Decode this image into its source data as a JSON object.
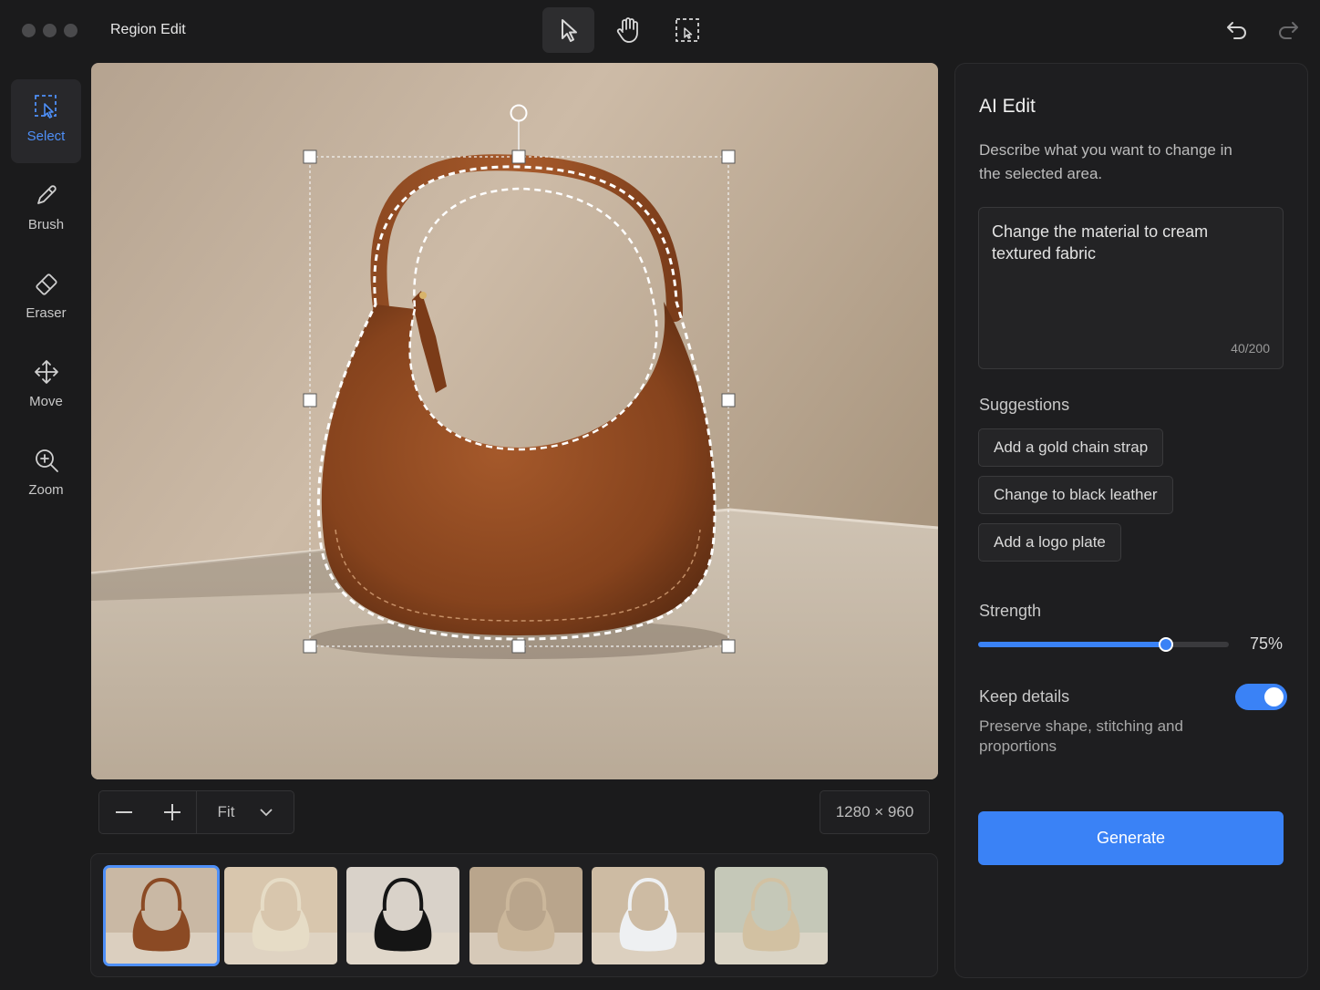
{
  "window": {
    "title": "Region Edit"
  },
  "top_toolbar": {
    "tools": [
      {
        "name": "pointer",
        "icon": "cursor-arrow-icon",
        "active": true
      },
      {
        "name": "hand",
        "icon": "hand-icon",
        "active": false
      },
      {
        "name": "region",
        "icon": "region-select-icon",
        "active": false
      }
    ],
    "undo_icon": "undo-icon",
    "redo_icon": "redo-icon"
  },
  "left_tools": [
    {
      "label": "Select",
      "icon": "select-region-icon",
      "active": true
    },
    {
      "label": "Brush",
      "icon": "brush-icon",
      "active": false
    },
    {
      "label": "Eraser",
      "icon": "eraser-icon",
      "active": false
    },
    {
      "label": "Move",
      "icon": "move-icon",
      "active": false
    },
    {
      "label": "Zoom",
      "icon": "zoom-icon",
      "active": false
    }
  ],
  "canvas": {
    "subject": "brown-leather-handbag",
    "zoom_fit_label": "Fit",
    "dimensions": "1280 × 960"
  },
  "filmstrip": {
    "selected_index": 0,
    "variants": [
      {
        "bag_color": "#8b4a24",
        "bg": "#c9b8a4"
      },
      {
        "bag_color": "#e6dcc6",
        "bg": "#d8c6ad"
      },
      {
        "bag_color": "#151515",
        "bg": "#d9d2c9"
      },
      {
        "bag_color": "#cbb79b",
        "bg": "#b9a58c"
      },
      {
        "bag_color": "#eef0f2",
        "bg": "#cdbba3"
      },
      {
        "bag_color": "#d2c1a2",
        "bg": "#c5c8b8"
      }
    ]
  },
  "panel": {
    "title": "AI Edit",
    "description": "Describe what you want to change in the selected area.",
    "prompt": {
      "value": "Change the material to cream textured fabric",
      "count": "40/200"
    },
    "suggestions_title": "Suggestions",
    "suggestions": [
      "Add a gold chain strap",
      "Change to black leather",
      "Add a logo plate"
    ],
    "strength": {
      "label": "Strength",
      "value": 0.75,
      "display": "75%"
    },
    "keep_details": {
      "label": "Keep details",
      "enabled": true,
      "description": "Preserve shape, stitching and proportions"
    },
    "generate_label": "Generate"
  },
  "colors": {
    "accent": "#3a82f6",
    "background": "#1b1b1c",
    "panel": "#1e1e20"
  }
}
